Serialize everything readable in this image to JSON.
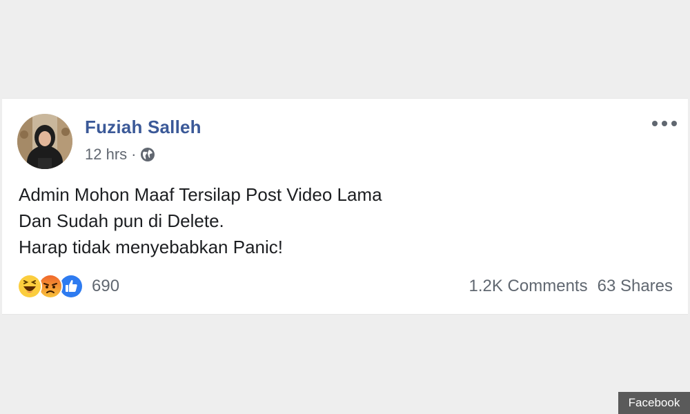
{
  "post": {
    "author": "Fuziah Salleh",
    "time": "12 hrs",
    "separator": "·",
    "privacy_icon": "globe-icon",
    "more_icon": "more-options-icon",
    "lines": [
      "Admin Mohon Maaf Tersilap Post Video Lama",
      "Dan Sudah pun di Delete.",
      "Harap tidak menyebabkan Panic!"
    ],
    "reactions": {
      "icons": [
        "haha-icon",
        "angry-icon",
        "like-icon"
      ],
      "count": "690"
    },
    "comments": "1.2K Comments",
    "shares": "63 Shares"
  },
  "colors": {
    "author_link": "#3b5998",
    "like_blue": "#2e7bf0",
    "haha_yellow": "#fbcd3e",
    "angry_orange": "#f0672b"
  },
  "watermark": "Facebook"
}
